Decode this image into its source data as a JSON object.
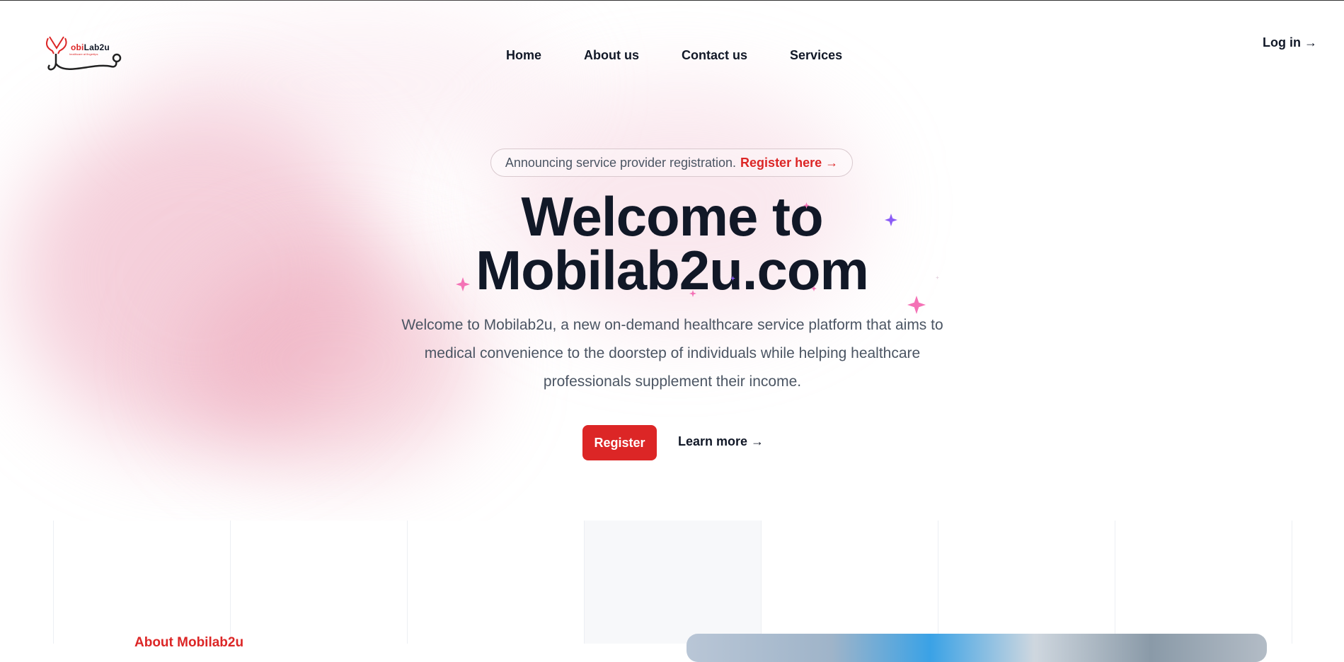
{
  "brand": {
    "logo_part1": "obi",
    "logo_part2": "Lab2u",
    "tagline": "healthcare at fingertips"
  },
  "nav": {
    "items": [
      "Home",
      "About us",
      "Contact us",
      "Services"
    ]
  },
  "header": {
    "login": "Log in →"
  },
  "announcement": {
    "text": "Announcing service provider registration.",
    "link": "Register here →"
  },
  "hero": {
    "title_line1": "Welcome to",
    "title_line2": "Mobilab2u.com",
    "description": "Welcome to Mobilab2u, a new on-demand healthcare service platform that aims to medical convenience to the doorstep of individuals while helping healthcare professionals supplement their income.",
    "register_button": "Register",
    "learn_more": "Learn more →"
  },
  "about": {
    "label": "About Mobilab2u"
  },
  "colors": {
    "accent": "#dc2626",
    "text": "#111827",
    "muted": "#4b5563",
    "sparkle_pink": "#f472b6",
    "sparkle_purple": "#8b5cf6"
  },
  "icons": [
    "stethoscope-logo-icon",
    "sparkle-icon"
  ]
}
